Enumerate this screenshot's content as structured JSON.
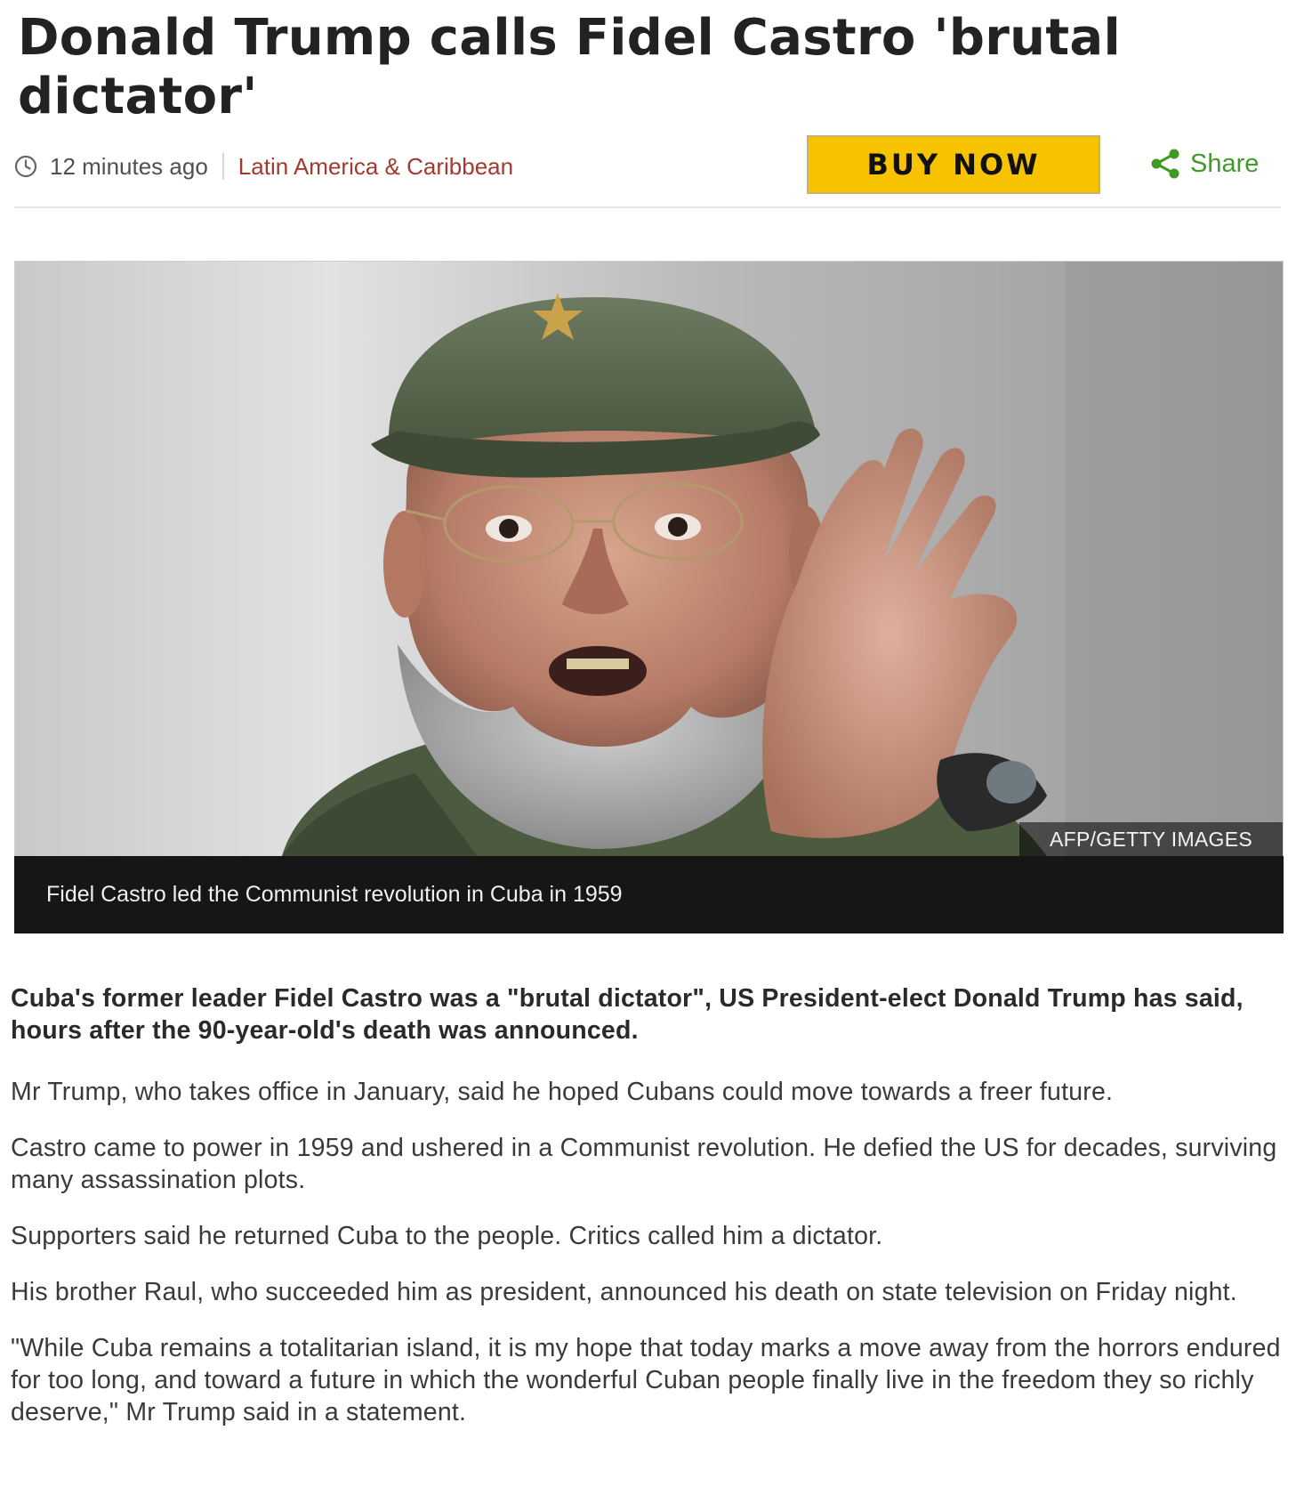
{
  "article": {
    "headline": "Donald Trump calls Fidel Castro 'brutal dictator'",
    "timestamp": "12 minutes ago",
    "section": "Latin America & Caribbean",
    "buy_button": "BUY NOW",
    "share_label": "Share",
    "image": {
      "credit": "AFP/GETTY IMAGES",
      "caption": "Fidel Castro led the Communist revolution in Cuba in 1959"
    },
    "intro": "Cuba's former leader Fidel Castro was a \"brutal dictator\", US President-elect Donald Trump has said, hours after the 90-year-old's death was announced.",
    "paragraphs": [
      "Mr Trump, who takes office in January, said he hoped Cubans could move towards a freer future.",
      "Castro came to power in 1959 and ushered in a Communist revolution. He defied the US for decades, surviving many assassination plots.",
      "Supporters said he returned Cuba to the people. Critics called him a dictator.",
      "His brother Raul, who succeeded him as president, announced his death on state television on Friday night.",
      "\"While Cuba remains a totalitarian island, it is my hope that today marks a move away from the horrors endured for too long, and toward a future in which the wonderful Cuban people finally live in the freedom they so richly deserve,\" Mr Trump said in a statement."
    ]
  },
  "colors": {
    "section_link": "#a33a2f",
    "buy_button_bg": "#f7c300",
    "share_green": "#3f9b27",
    "caption_bg": "#161616"
  },
  "icons": {
    "time": "clock-icon",
    "share": "share-icon"
  }
}
